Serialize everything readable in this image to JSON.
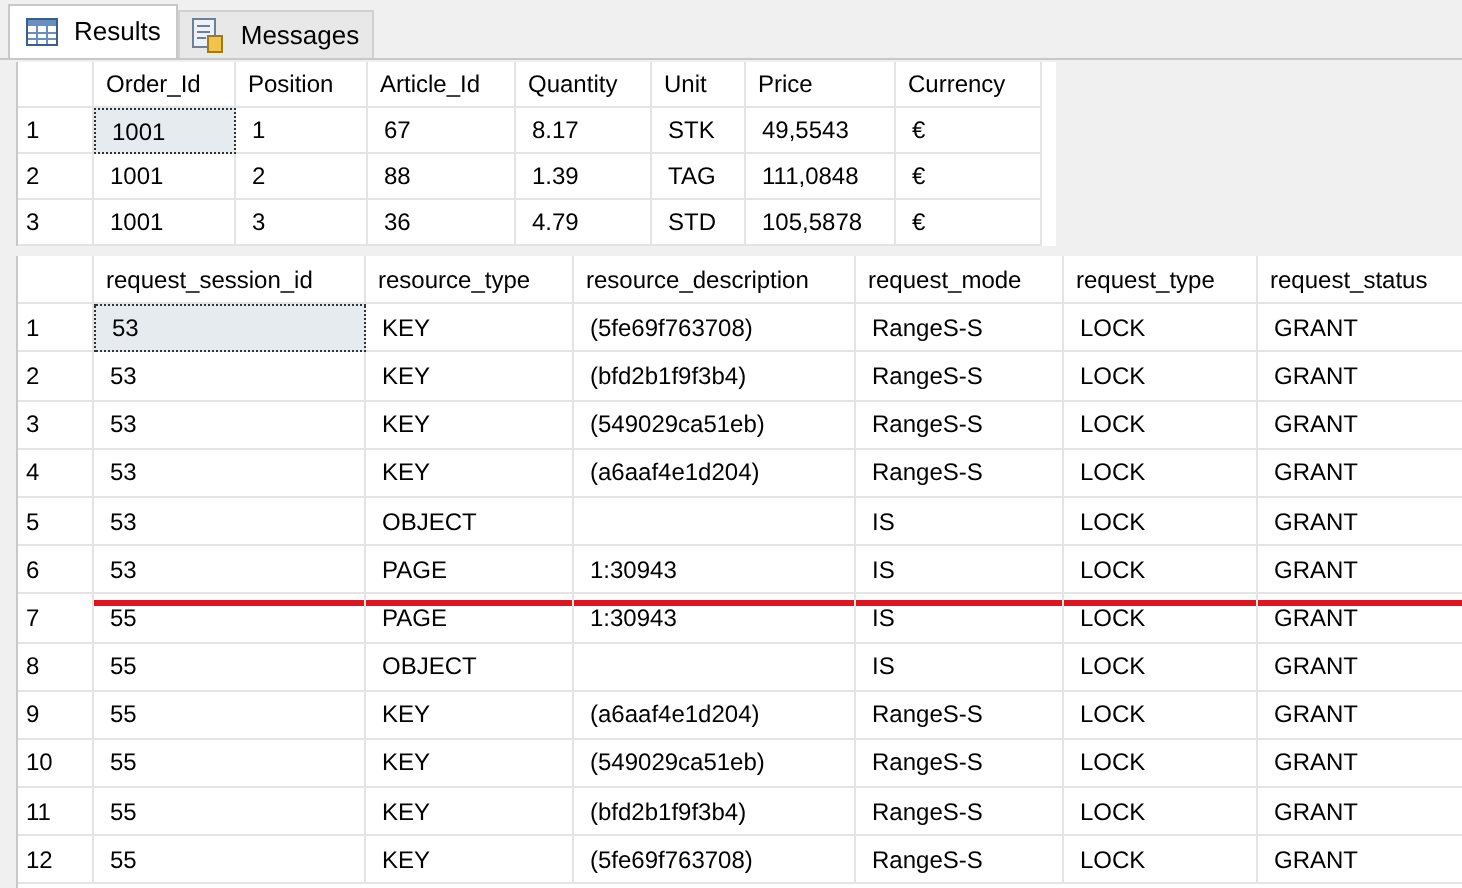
{
  "tabs": [
    {
      "label": "Results",
      "kind": "grid",
      "selected": true
    },
    {
      "label": "Messages",
      "kind": "document",
      "selected": false
    }
  ],
  "grids": [
    {
      "columns": [
        "Order_Id",
        "Position",
        "Article_Id",
        "Quantity",
        "Unit",
        "Price",
        "Currency"
      ],
      "rows": [
        {
          "number": "1",
          "selected": true,
          "marked": false,
          "cells": [
            "1001",
            "1",
            "67",
            "8.17",
            "STK",
            "49,5543",
            "€"
          ]
        },
        {
          "number": "2",
          "selected": false,
          "marked": false,
          "cells": [
            "1001",
            "2",
            "88",
            "1.39",
            "TAG",
            "111,0848",
            "€"
          ]
        },
        {
          "number": "3",
          "selected": false,
          "marked": false,
          "cells": [
            "1001",
            "3",
            "36",
            "4.79",
            "STD",
            "105,5878",
            "€"
          ]
        }
      ]
    },
    {
      "columns": [
        "request_session_id",
        "resource_type",
        "resource_description",
        "request_mode",
        "request_type",
        "request_status"
      ],
      "rows": [
        {
          "number": "1",
          "selected": true,
          "marked": false,
          "cells": [
            "53",
            "KEY",
            "(5fe69f763708)",
            "RangeS-S",
            "LOCK",
            "GRANT"
          ]
        },
        {
          "number": "2",
          "selected": false,
          "marked": false,
          "cells": [
            "53",
            "KEY",
            "(bfd2b1f9f3b4)",
            "RangeS-S",
            "LOCK",
            "GRANT"
          ]
        },
        {
          "number": "3",
          "selected": false,
          "marked": false,
          "cells": [
            "53",
            "KEY",
            "(549029ca51eb)",
            "RangeS-S",
            "LOCK",
            "GRANT"
          ]
        },
        {
          "number": "4",
          "selected": false,
          "marked": false,
          "cells": [
            "53",
            "KEY",
            "(a6aaf4e1d204)",
            "RangeS-S",
            "LOCK",
            "GRANT"
          ]
        },
        {
          "number": "5",
          "selected": false,
          "marked": false,
          "cells": [
            "53",
            "OBJECT",
            "",
            "IS",
            "LOCK",
            "GRANT"
          ]
        },
        {
          "number": "6",
          "selected": false,
          "marked": true,
          "cells": [
            "53",
            "PAGE",
            "1:30943",
            "IS",
            "LOCK",
            "GRANT"
          ]
        },
        {
          "number": "7",
          "selected": false,
          "marked": false,
          "cells": [
            "55",
            "PAGE",
            "1:30943",
            "IS",
            "LOCK",
            "GRANT"
          ]
        },
        {
          "number": "8",
          "selected": false,
          "marked": false,
          "cells": [
            "55",
            "OBJECT",
            "",
            "IS",
            "LOCK",
            "GRANT"
          ]
        },
        {
          "number": "9",
          "selected": false,
          "marked": false,
          "cells": [
            "55",
            "KEY",
            "(a6aaf4e1d204)",
            "RangeS-S",
            "LOCK",
            "GRANT"
          ]
        },
        {
          "number": "10",
          "selected": false,
          "marked": false,
          "cells": [
            "55",
            "KEY",
            "(549029ca51eb)",
            "RangeS-S",
            "LOCK",
            "GRANT"
          ]
        },
        {
          "number": "11",
          "selected": false,
          "marked": false,
          "cells": [
            "55",
            "KEY",
            "(bfd2b1f9f3b4)",
            "RangeS-S",
            "LOCK",
            "GRANT"
          ]
        },
        {
          "number": "12",
          "selected": false,
          "marked": false,
          "cells": [
            "55",
            "KEY",
            "(5fe69f763708)",
            "RangeS-S",
            "LOCK",
            "GRANT"
          ]
        }
      ]
    }
  ]
}
